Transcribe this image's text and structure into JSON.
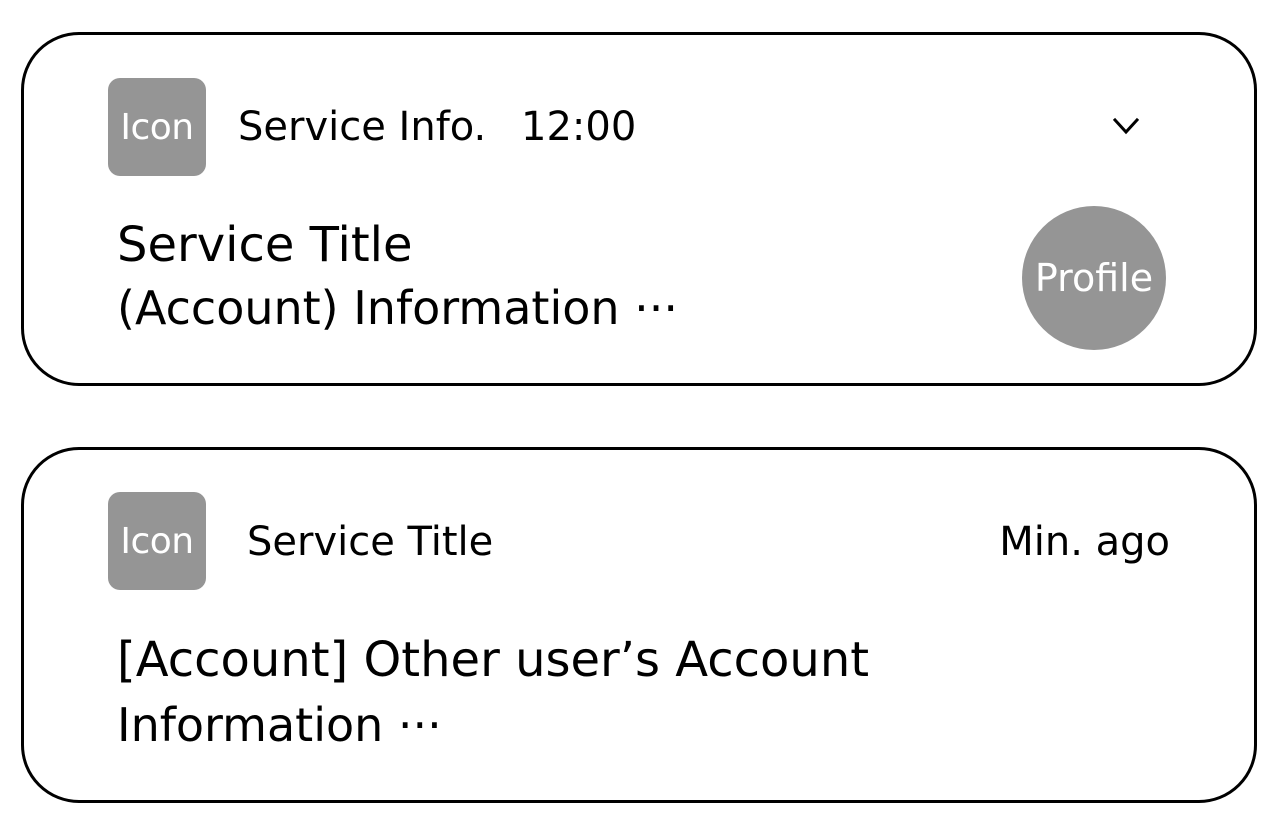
{
  "notifications": [
    {
      "icon_label": "Icon",
      "service_info": "Service Info.",
      "time": "12:00",
      "expand_icon": "chevron-down-icon",
      "title": "Service Title",
      "body": "(Account) Information ···",
      "profile_label": "Profile"
    },
    {
      "icon_label": "Icon",
      "service_title": "Service Title",
      "time_ago": "Min. ago",
      "title": "[Account] Other user’s Account",
      "body": "Information ···"
    }
  ],
  "colors": {
    "placeholder_gray": "#959595",
    "border": "#000000",
    "background": "#ffffff"
  }
}
